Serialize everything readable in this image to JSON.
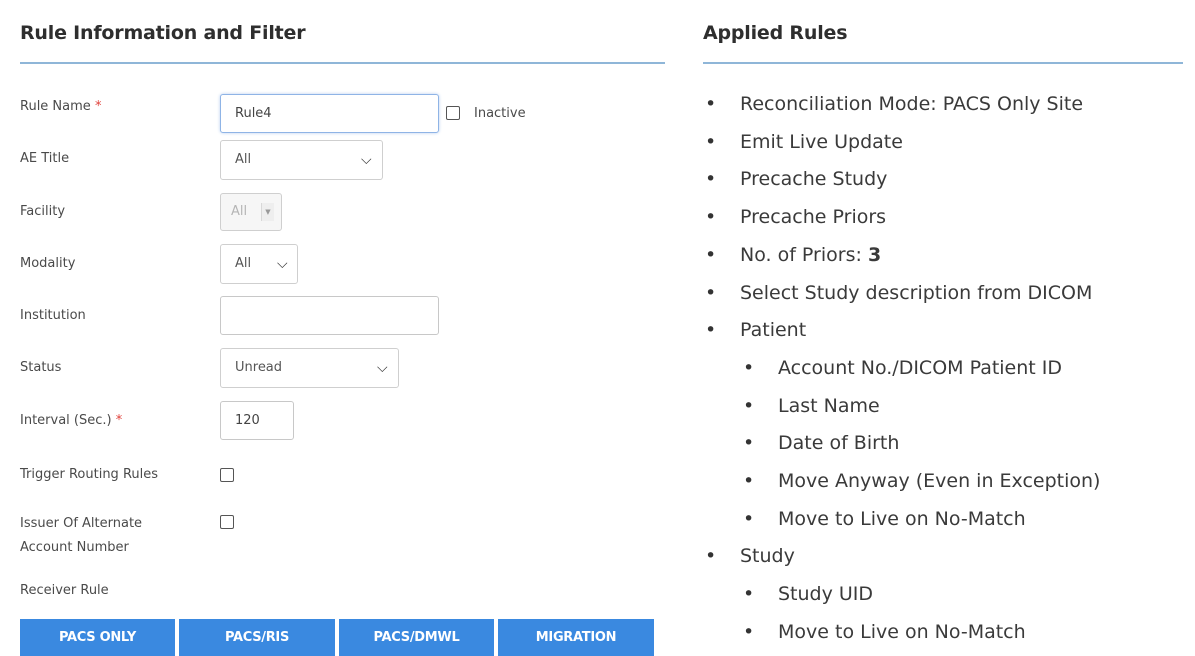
{
  "left": {
    "title": "Rule Information and Filter",
    "rule_name": {
      "label": "Rule Name",
      "required_mark": "*",
      "value": "Rule4"
    },
    "inactive": {
      "label": "Inactive",
      "checked": false
    },
    "ae_title": {
      "label": "AE Title",
      "value": "All"
    },
    "facility": {
      "label": "Facility",
      "value": "All",
      "disabled": true
    },
    "modality": {
      "label": "Modality",
      "value": "All"
    },
    "institution": {
      "label": "Institution",
      "value": ""
    },
    "status": {
      "label": "Status",
      "value": "Unread"
    },
    "interval": {
      "label": "Interval (Sec.)",
      "required_mark": "*",
      "value": "120"
    },
    "trigger_routing": {
      "label": "Trigger Routing Rules",
      "checked": false
    },
    "issuer_alt": {
      "label_line1": "Issuer Of Alternate",
      "label_line2": "Account Number",
      "checked": false
    },
    "receiver_rule": {
      "label": "Receiver Rule"
    },
    "buttons": [
      "PACS ONLY",
      "PACS/RIS",
      "PACS/DMWL",
      "MIGRATION"
    ],
    "colors": {
      "accent": "#3a89e0",
      "rule_line": "#8fb6d8",
      "required": "#e0403a"
    }
  },
  "right": {
    "title": "Applied Rules",
    "items": [
      {
        "text": "Reconciliation Mode: PACS Only Site"
      },
      {
        "text": "Emit Live Update"
      },
      {
        "text": "Precache Study"
      },
      {
        "text": "Precache Priors"
      },
      {
        "text": "No. of Priors: ",
        "value": "3"
      },
      {
        "text": "Select Study description from DICOM"
      },
      {
        "text": "Patient"
      },
      {
        "text": "Account No./DICOM Patient ID",
        "sub": true
      },
      {
        "text": "Last Name",
        "sub": true
      },
      {
        "text": "Date of Birth",
        "sub": true
      },
      {
        "text": "Move Anyway (Even in Exception)",
        "sub": true
      },
      {
        "text": "Move to Live on No-Match",
        "sub": true
      },
      {
        "text": "Study"
      },
      {
        "text": "Study UID",
        "sub": true
      },
      {
        "text": "Move to Live on No-Match",
        "sub": true
      }
    ]
  },
  "icons": {
    "chevron": "chevron-down-icon",
    "bullet": "bullet-icon"
  }
}
